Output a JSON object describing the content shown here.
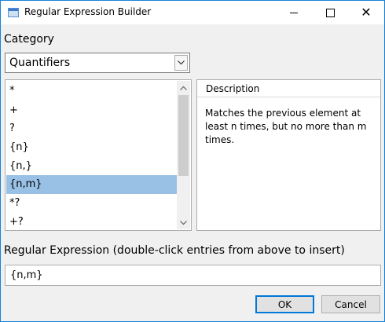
{
  "window": {
    "title": "Regular Expression Builder",
    "minimize_icon": "minimize-icon",
    "maximize_icon": "maximize-icon",
    "close_icon": "close-icon"
  },
  "category": {
    "label": "Category",
    "selected": "Quantifiers",
    "dropdown_icon": "chevron-down-icon"
  },
  "list": {
    "items": [
      "*",
      "+",
      "?",
      "{n}",
      "{n,}",
      "{n,m}",
      "*?",
      "+?"
    ],
    "selected_index": 5,
    "scroll_up_icon": "chevron-up-icon",
    "scroll_down_icon": "chevron-down-icon"
  },
  "description": {
    "header": "Description",
    "text": "Matches the previous element at least n times, but no more than m times."
  },
  "regex": {
    "label": "Regular Expression (double-click entries from above to insert)",
    "value": "{n,m}"
  },
  "buttons": {
    "ok": "OK",
    "cancel": "Cancel"
  },
  "colors": {
    "accent": "#0078d7",
    "selection": "#99c1e6",
    "window_border": "#1883d7"
  }
}
